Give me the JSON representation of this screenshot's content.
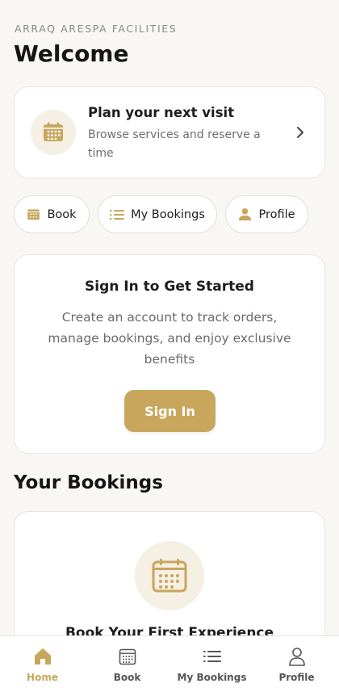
{
  "header": {
    "eyebrow": "ARRAQ ARESPA FACILITIES",
    "title": "Welcome"
  },
  "plan_card": {
    "title": "Plan your next visit",
    "subtitle": "Browse services and reserve a time",
    "icon": "calendar-icon"
  },
  "quick_actions": [
    {
      "label": "Book",
      "icon": "calendar-icon"
    },
    {
      "label": "My Bookings",
      "icon": "list-icon"
    },
    {
      "label": "Profile",
      "icon": "user-icon"
    }
  ],
  "signin_card": {
    "title": "Sign In to Get Started",
    "body": "Create an account to track orders, manage bookings, and enjoy exclusive benefits",
    "button_label": "Sign In"
  },
  "bookings_section": {
    "title": "Your Bookings",
    "empty_title": "Book Your First Experience",
    "icon": "calendar-icon"
  },
  "tabbar": {
    "tabs": [
      {
        "label": "Home",
        "icon": "home-icon",
        "active": true
      },
      {
        "label": "Book",
        "icon": "calendar-icon",
        "active": false
      },
      {
        "label": "My Bookings",
        "icon": "list-icon",
        "active": false
      },
      {
        "label": "Profile",
        "icon": "user-icon",
        "active": false
      }
    ]
  },
  "colors": {
    "accent": "#c8a65c",
    "background": "#f8f7f3",
    "icon_circle": "#f5efe4"
  }
}
